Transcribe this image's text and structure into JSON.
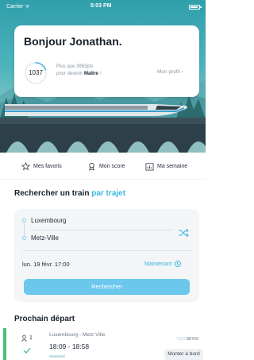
{
  "status_bar": {
    "carrier": "Carrier ᯤ",
    "time": "5:03 PM",
    "battery_level": 0.85
  },
  "greeting": {
    "title": "Bonjour Jonathan.",
    "score": "1037",
    "points_line1": "Plus que 3963pts",
    "points_line2_prefix": "pour devenir ",
    "points_line2_level": "Maître",
    "points_line2_suffix": " !",
    "profile_label": "Mon profil ›",
    "progress": 0.2
  },
  "quick_links": [
    {
      "label": "Mes favoris",
      "icon": "star-icon"
    },
    {
      "label": "Mon score",
      "icon": "medal-icon"
    },
    {
      "label": "Ma semaine",
      "icon": "calendar-chart-icon"
    }
  ],
  "search": {
    "title_prefix": "Rechercher un train ",
    "title_accent": "par trajet",
    "from": "Luxembourg",
    "to": "Metz-Ville",
    "date": "lun. 19 févr. 17:00",
    "now_label": "Maintenant",
    "button_label": "Rechercher",
    "swap_icon": "swap-icon",
    "clock_icon": "clock-icon"
  },
  "next_departure": {
    "title": "Prochain départ",
    "passengers": "1",
    "route": "Luxembourg - Metz-Ville",
    "times": "18:09 - 18:58",
    "train_type": "TER",
    "train_number": "88759",
    "board_label": "Monter à bord"
  },
  "colors": {
    "accent": "#3cb7e0",
    "button": "#6cc7ec",
    "success": "#41c37a"
  }
}
